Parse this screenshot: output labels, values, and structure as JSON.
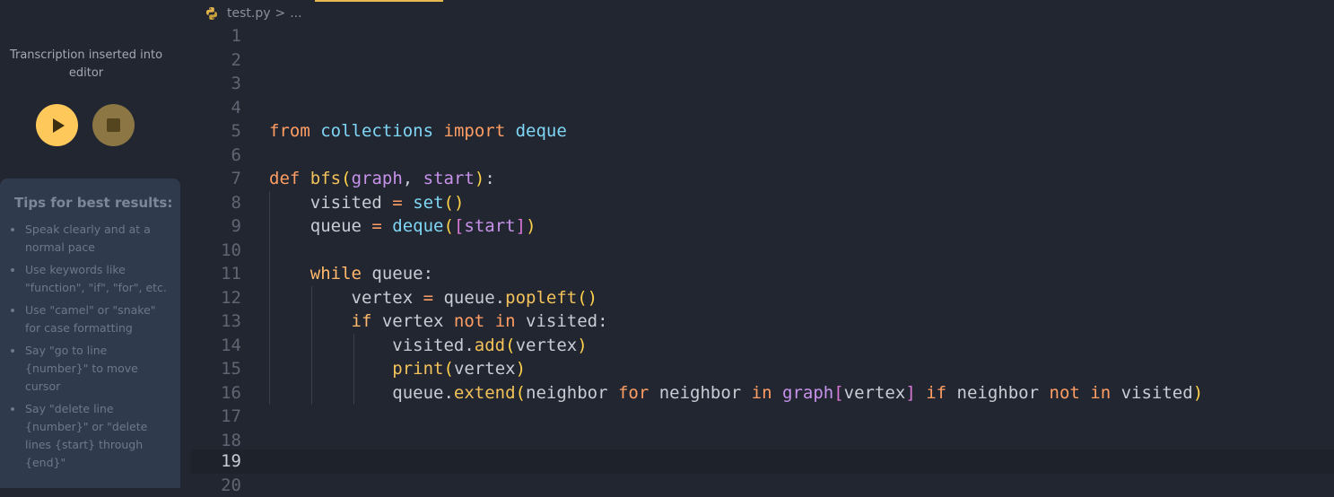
{
  "sidebar": {
    "status": "Transcription inserted into editor",
    "play_icon": "play-icon",
    "stop_icon": "stop-icon",
    "tips_title": "Tips for best results:",
    "tips": [
      "Speak clearly and at a normal pace",
      "Use keywords like \"function\", \"if\", \"for\", etc.",
      "Use \"camel\" or \"snake\" for case formatting",
      "Say \"go to line {number}\" to move cursor",
      "Say \"delete line {number}\" or \"delete lines {start} through {end}\""
    ]
  },
  "breadcrumb": {
    "file": "test.py",
    "separator": ">",
    "more": "..."
  },
  "colors": {
    "background": "#222631",
    "accent": "#ffc85b",
    "keyword": "#ff9e64",
    "function": "#f3c35a",
    "builtin": "#7fd6f5"
  },
  "editor": {
    "current_line": 19,
    "line_numbers": [
      "1",
      "2",
      "3",
      "4",
      "5",
      "6",
      "7",
      "8",
      "9",
      "10",
      "11",
      "12",
      "13",
      "14",
      "15",
      "16",
      "17",
      "18",
      "19",
      "20"
    ],
    "code": {
      "l5": [
        "from",
        " ",
        "collections",
        " ",
        "import",
        " ",
        "deque"
      ],
      "l7": [
        "def",
        " ",
        "bfs",
        "(",
        "graph",
        ", ",
        "start",
        ")",
        ":"
      ],
      "l8": [
        "    visited ",
        "=",
        " ",
        "set",
        "(",
        ")"
      ],
      "l9": [
        "    queue ",
        "=",
        " ",
        "deque",
        "(",
        "[",
        "start",
        "]",
        ")"
      ],
      "l11": [
        "    ",
        "while",
        " queue:"
      ],
      "l12": [
        "        vertex ",
        "=",
        " queue.",
        "popleft",
        "(",
        ")"
      ],
      "l13": [
        "        ",
        "if",
        " vertex ",
        "not",
        " ",
        "in",
        " visited:"
      ],
      "l14": [
        "            visited.",
        "add",
        "(",
        "vertex",
        ")"
      ],
      "l15": [
        "            ",
        "print",
        "(",
        "vertex",
        ")"
      ],
      "l16": [
        "            queue.",
        "extend",
        "(",
        "neighbor ",
        "for",
        " neighbor ",
        "in",
        " ",
        "graph",
        "[",
        "vertex",
        "]",
        " ",
        "if",
        " neighbor ",
        "not",
        " ",
        "in",
        " visited",
        ")"
      ]
    }
  }
}
